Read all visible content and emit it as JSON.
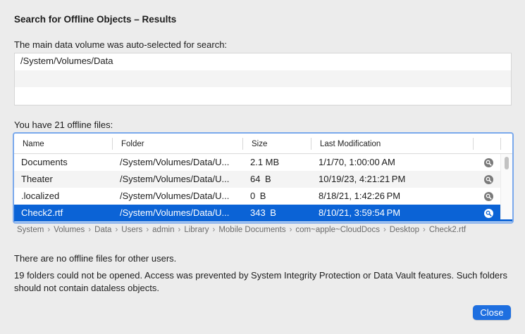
{
  "dialog": {
    "title": "Search for Offline Objects – Results",
    "volume_label": "The main data volume was auto-selected for search:",
    "volumes": [
      "/System/Volumes/Data",
      "",
      ""
    ],
    "files_label": "You have 21 offline files:",
    "columns": {
      "name": "Name",
      "folder": "Folder",
      "size": "Size",
      "modified": "Last Modification"
    },
    "rows": [
      {
        "name": "Documents",
        "folder": "/System/Volumes/Data/U...",
        "size": "2.1 MB",
        "modified": "1/1/70, 1:00:00 AM"
      },
      {
        "name": "Theater",
        "folder": "/System/Volumes/Data/U...",
        "size": "64 B",
        "modified": "10/19/23, 4:21:21 PM"
      },
      {
        "name": ".localized",
        "folder": "/System/Volumes/Data/U...",
        "size": "0 B",
        "modified": "8/18/21, 1:42:26 PM"
      },
      {
        "name": "Check2.rtf",
        "folder": "/System/Volumes/Data/U...",
        "size": "343 B",
        "modified": "8/10/21, 3:59:54 PM",
        "selected": true
      }
    ],
    "path": [
      "System",
      "Volumes",
      "Data",
      "Users",
      "admin",
      "Library",
      "Mobile Documents",
      "com~apple~CloudDocs",
      "Desktop",
      "Check2.rtf"
    ],
    "no_other_users": "There are no offline files for other users.",
    "folders_note": "19 folders could not be opened. Access was prevented by System Integrity Protection or Data Vault features. Such folders should not contain dataless objects.",
    "close_label": "Close",
    "accent_color": "#0b63d6"
  }
}
